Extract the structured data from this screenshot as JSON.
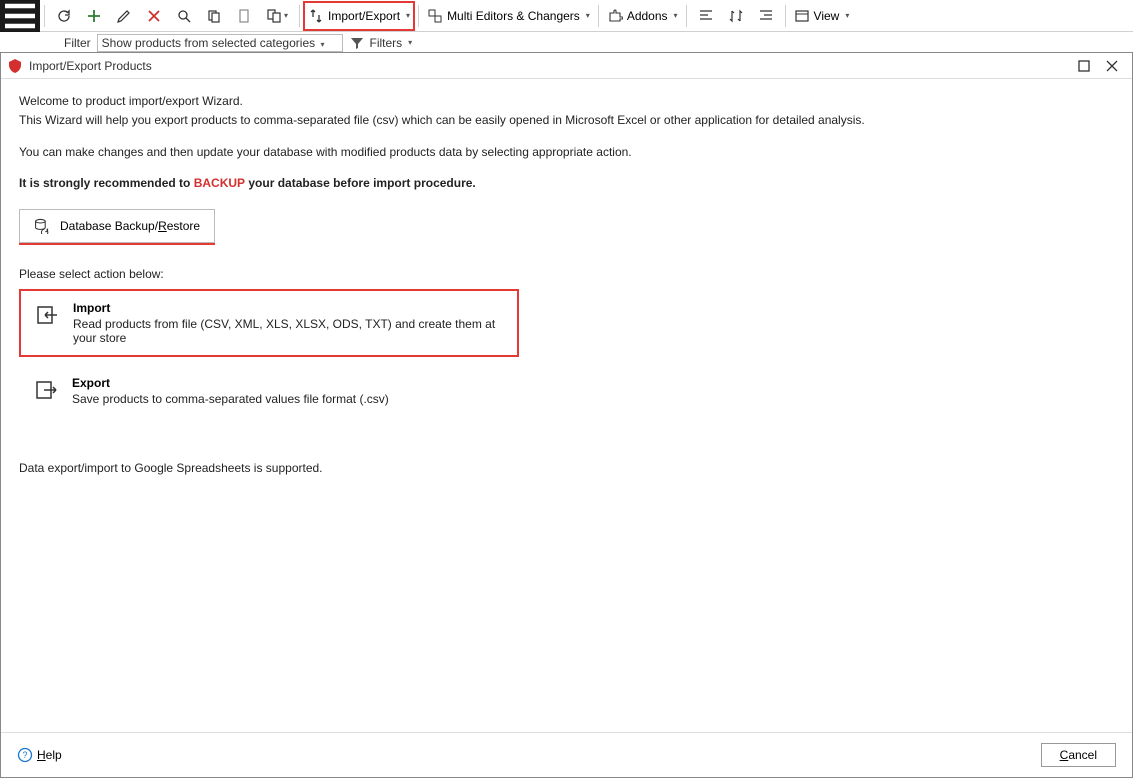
{
  "toolbar": {
    "import_export_label": "Import/Export",
    "multi_editors_label": "Multi Editors & Changers",
    "addons_label": "Addons",
    "view_label": "View"
  },
  "filterbar": {
    "label": "Filter",
    "select_value": "Show products from selected categories",
    "filters_label": "Filters"
  },
  "dialog": {
    "title": "Import/Export Products",
    "welcome_line1": "Welcome to product import/export Wizard.",
    "welcome_line2": "This Wizard will help you export products to comma-separated file (csv) which can be easily opened in Microsoft Excel or other application for detailed analysis.",
    "welcome_line3": "You can make changes and then update your database with modified products data by selecting appropriate action.",
    "backup_prefix": "It is strongly recommended to ",
    "backup_word": "BACKUP",
    "backup_suffix": " your database before import procedure.",
    "backup_btn_prefix": "Database Backup/",
    "backup_btn_key": "R",
    "backup_btn_suffix": "estore",
    "select_action": "Please select action below:",
    "import_title": "Import",
    "import_desc": "Read products from file (CSV, XML, XLS, XLSX, ODS, TXT) and create them at your store",
    "export_title": "Export",
    "export_desc": "Save products to comma-separated values file format (.csv)",
    "google_note": "Data export/import to Google Spreadsheets is supported.",
    "help_key": "H",
    "help_rest": "elp",
    "cancel_key": "C",
    "cancel_rest": "ancel"
  }
}
